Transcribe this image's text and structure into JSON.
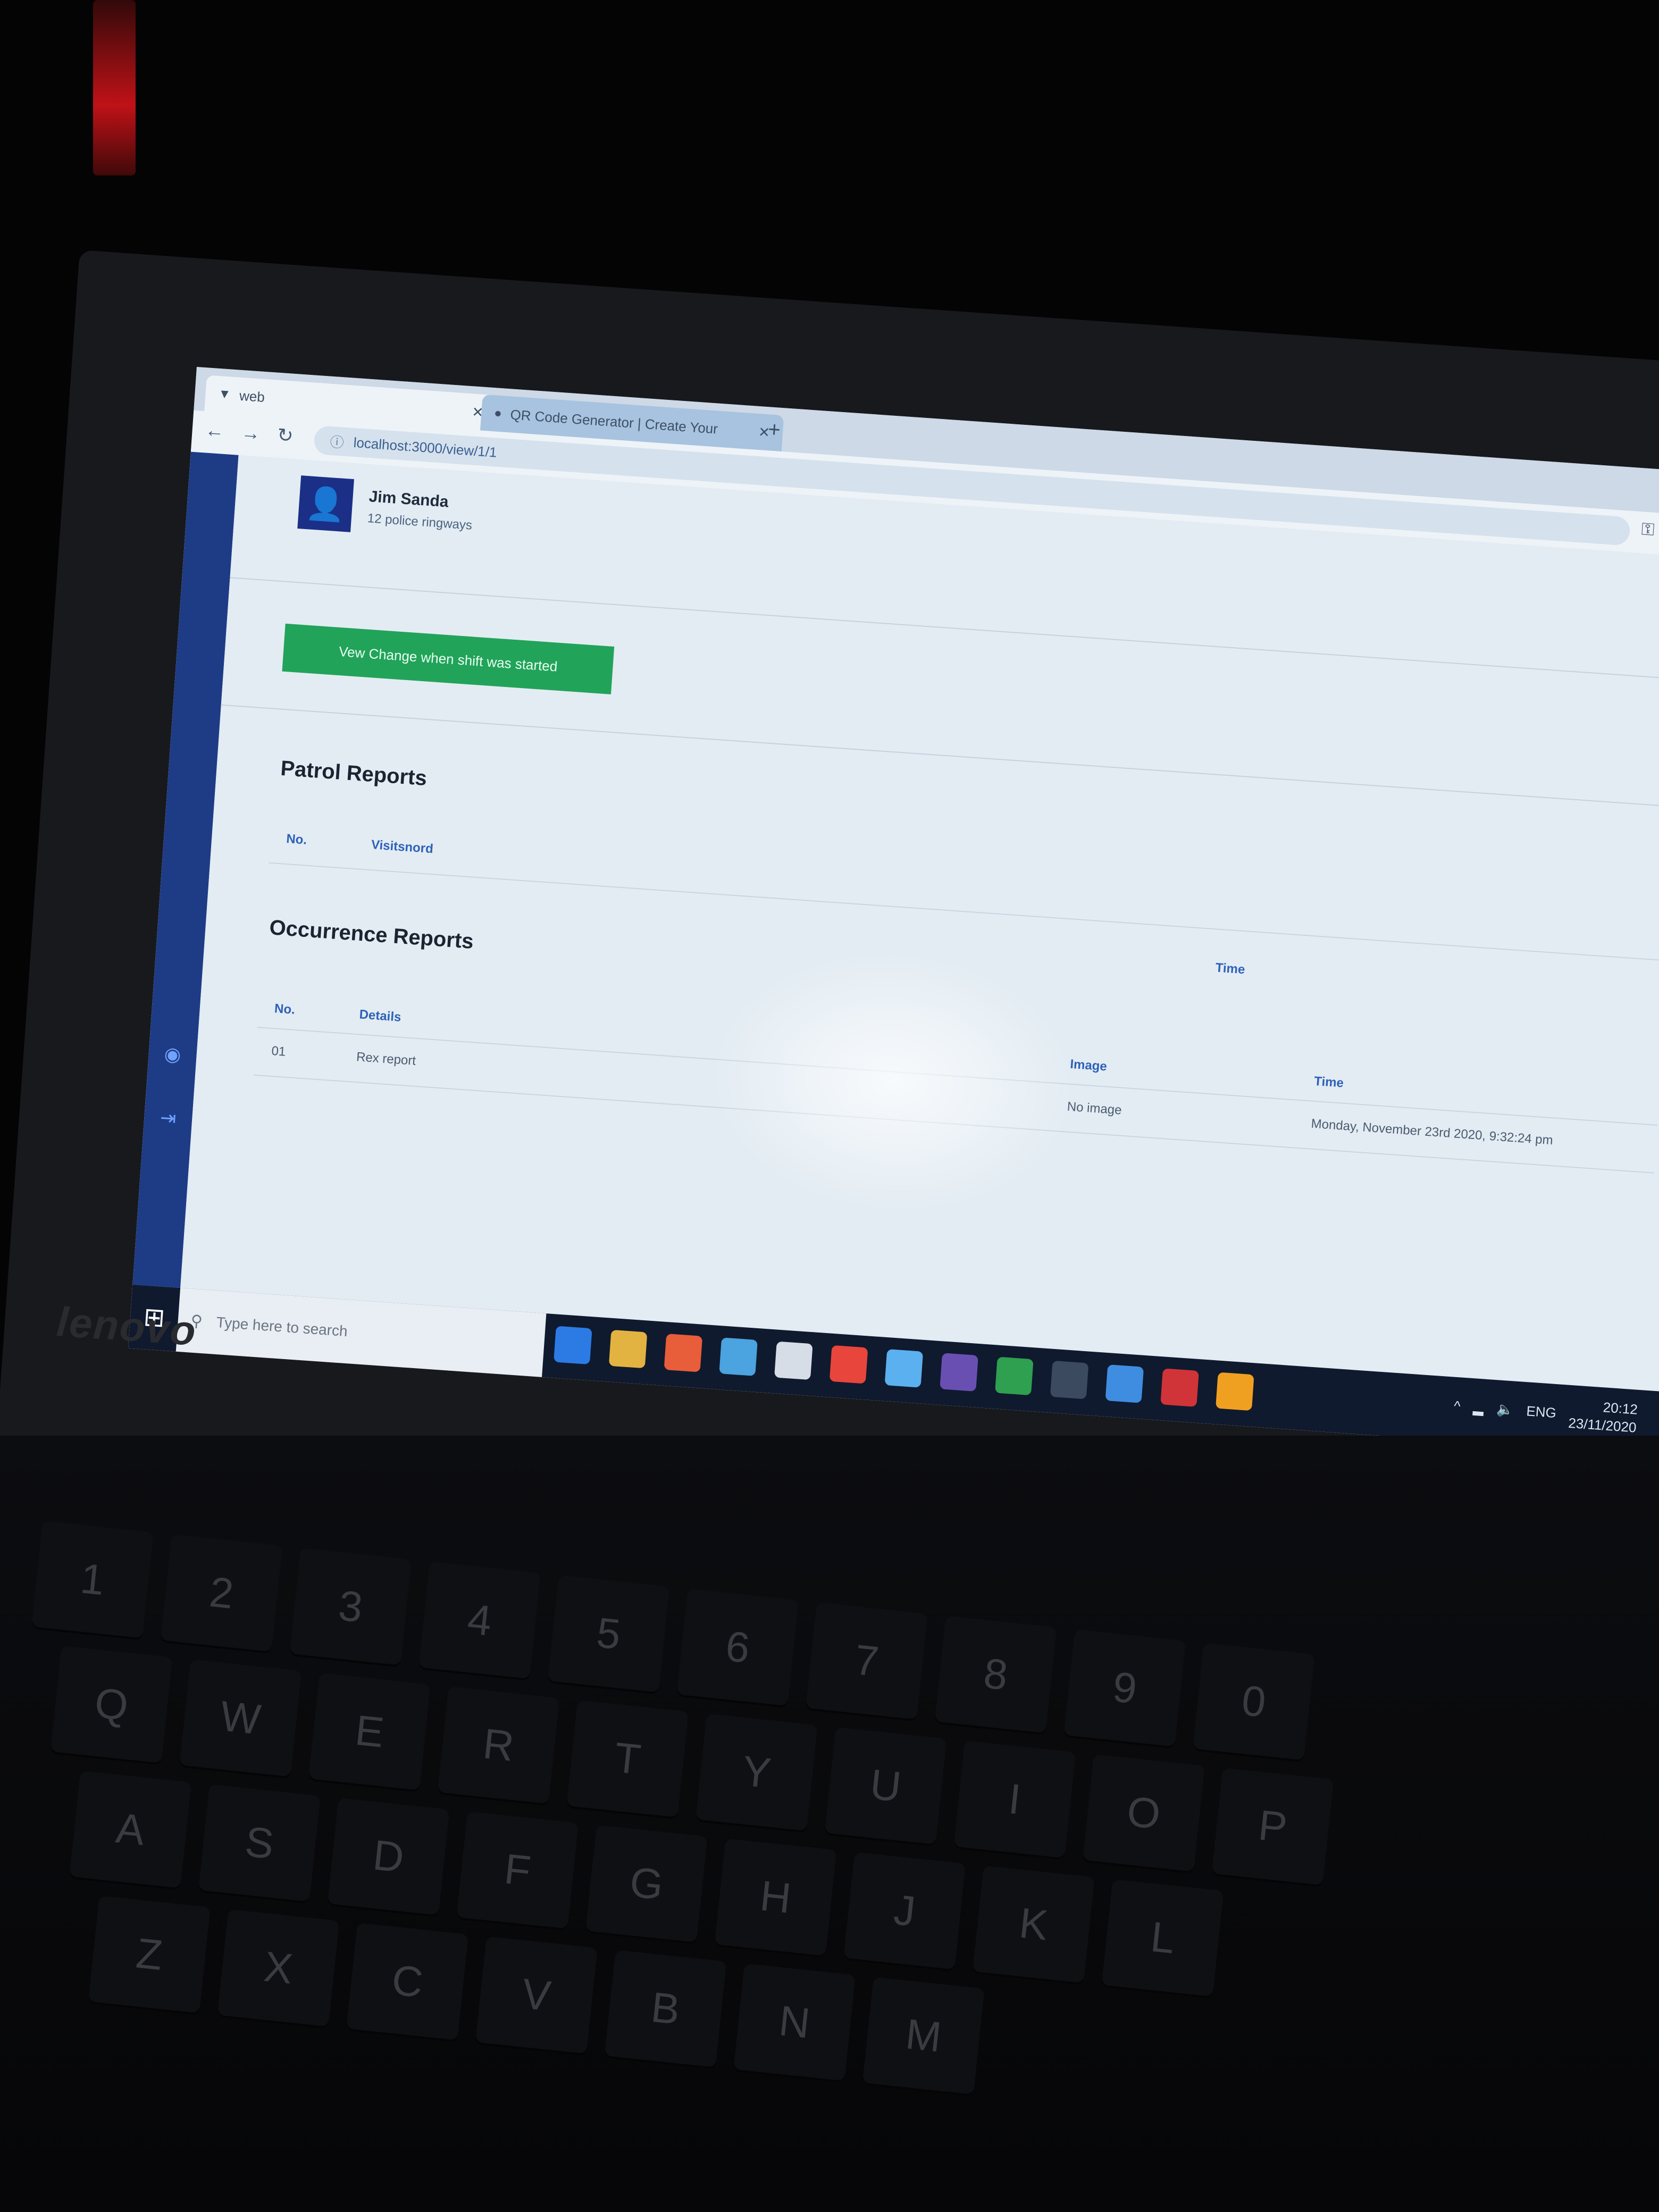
{
  "browser": {
    "active_tab_title": "web",
    "inactive_tab_title": "QR Code Generator | Create Your",
    "url": "localhost:3000/view/1/1",
    "new_tab_symbol": "+"
  },
  "profile": {
    "name": "Jim Sanda",
    "subtitle": "12 police ringways"
  },
  "action_button": {
    "label": "Vew Change when shift was started"
  },
  "patrol_reports": {
    "title": "Patrol Reports",
    "columns": [
      "No.",
      "Visitsnord"
    ]
  },
  "occurrence_reports": {
    "title": "Occurrence Reports",
    "header_time_label": "Time",
    "columns": [
      "No.",
      "Details",
      "Image",
      "Time"
    ],
    "rows": [
      {
        "no": "01",
        "details": "Rex report",
        "image": "No image",
        "time": "Monday, November 23rd 2020, 9:32:24 pm"
      }
    ]
  },
  "taskbar": {
    "search_placeholder": "Type here to search",
    "language": "ENG",
    "time": "20:12",
    "date": "23/11/2020",
    "app_colors": [
      "#2c7be5",
      "#e3b341",
      "#e85d3a",
      "#4ba3e0",
      "#d7dde6",
      "#e8453c",
      "#5bb0f0",
      "#6a4fb3",
      "#2ea04f",
      "#3b4a5e",
      "#3f8de0",
      "#d13438",
      "#f0a020"
    ]
  },
  "laptop": {
    "brand": "lenovo",
    "keyboard_rows": [
      [
        "1",
        "2",
        "3",
        "4",
        "5",
        "6",
        "7",
        "8",
        "9",
        "0"
      ],
      [
        "Q",
        "W",
        "E",
        "R",
        "T",
        "Y",
        "U",
        "I",
        "O",
        "P"
      ],
      [
        "A",
        "S",
        "D",
        "F",
        "G",
        "H",
        "J",
        "K",
        "L"
      ],
      [
        "Z",
        "X",
        "C",
        "V",
        "B",
        "N",
        "M"
      ]
    ]
  }
}
